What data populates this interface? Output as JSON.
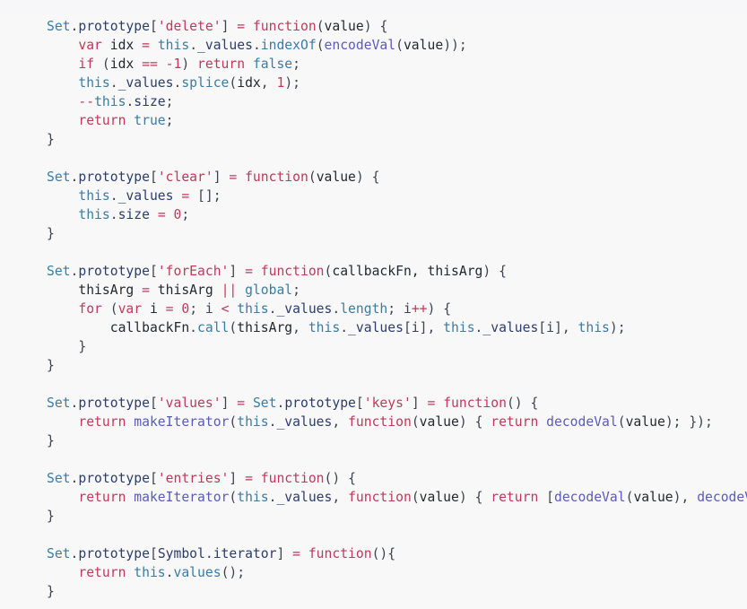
{
  "editor": {
    "language": "javascript",
    "background_color": "#f8f8f9",
    "default_text_color": "#24292e",
    "indent": "    ",
    "clipped_right_edge": true,
    "colors": {
      "class_or_builtin": "#3b7ca3",
      "property": "#2b3d6b",
      "keyword": "#c0395a",
      "string": "#c0395a",
      "number": "#c0395a",
      "operator": "#c0395a",
      "function_call": "#5a5ac0",
      "method": "#3b7ca3",
      "punctuation": "#3d4450"
    }
  },
  "code": {
    "lines": [
      "Set.prototype['delete'] = function(value) {",
      "    var idx = this._values.indexOf(encodeVal(value));",
      "    if (idx == -1) return false;",
      "    this._values.splice(idx, 1);",
      "    --this.size;",
      "    return true;",
      "}",
      "",
      "Set.prototype['clear'] = function(value) {",
      "    this._values = [];",
      "    this.size = 0;",
      "}",
      "",
      "Set.prototype['forEach'] = function(callbackFn, thisArg) {",
      "    thisArg = thisArg || global;",
      "    for (var i = 0; i < this._values.length; i++) {",
      "        callbackFn.call(thisArg, this._values[i], this._values[i], this);",
      "    }",
      "}",
      "",
      "Set.prototype['values'] = Set.prototype['keys'] = function() {",
      "    return makeIterator(this._values, function(value) { return decodeVal(value); });",
      "}",
      "",
      "Set.prototype['entries'] = function() {",
      "    return makeIterator(this._values, function(value) { return [decodeVal(value), decodeVal(value",
      "}",
      "",
      "Set.prototype[Symbol.iterator] = function(){",
      "    return this.values();",
      "}"
    ],
    "tokens": [
      [
        [
          "Set",
          "cls"
        ],
        [
          ".",
          "punc"
        ],
        [
          "prototype",
          "prop"
        ],
        [
          "[",
          "punc"
        ],
        [
          "'delete'",
          "str"
        ],
        [
          "]",
          "punc"
        ],
        [
          " ",
          "plain"
        ],
        [
          "=",
          "op"
        ],
        [
          " ",
          "plain"
        ],
        [
          "function",
          "kw"
        ],
        [
          "(",
          "punc"
        ],
        [
          "value",
          "plain"
        ],
        [
          ")",
          "punc"
        ],
        [
          " ",
          "plain"
        ],
        [
          "{",
          "punc"
        ]
      ],
      [
        [
          "    ",
          "plain"
        ],
        [
          "var",
          "kw"
        ],
        [
          " idx ",
          "plain"
        ],
        [
          "=",
          "op"
        ],
        [
          " ",
          "plain"
        ],
        [
          "this",
          "cls"
        ],
        [
          ".",
          "punc"
        ],
        [
          "_values",
          "prop"
        ],
        [
          ".",
          "punc"
        ],
        [
          "indexOf",
          "meth"
        ],
        [
          "(",
          "punc"
        ],
        [
          "encodeVal",
          "fn"
        ],
        [
          "(",
          "punc"
        ],
        [
          "value",
          "plain"
        ],
        [
          "))",
          "punc"
        ],
        [
          ";",
          "punc"
        ]
      ],
      [
        [
          "    ",
          "plain"
        ],
        [
          "if",
          "kw"
        ],
        [
          " ",
          "plain"
        ],
        [
          "(",
          "punc"
        ],
        [
          "idx ",
          "plain"
        ],
        [
          "==",
          "op"
        ],
        [
          " ",
          "plain"
        ],
        [
          "-1",
          "num"
        ],
        [
          ")",
          "punc"
        ],
        [
          " ",
          "plain"
        ],
        [
          "return",
          "kw"
        ],
        [
          " ",
          "plain"
        ],
        [
          "false",
          "cls"
        ],
        [
          ";",
          "punc"
        ]
      ],
      [
        [
          "    ",
          "plain"
        ],
        [
          "this",
          "cls"
        ],
        [
          ".",
          "punc"
        ],
        [
          "_values",
          "prop"
        ],
        [
          ".",
          "punc"
        ],
        [
          "splice",
          "meth"
        ],
        [
          "(",
          "punc"
        ],
        [
          "idx",
          "plain"
        ],
        [
          ", ",
          "punc"
        ],
        [
          "1",
          "num"
        ],
        [
          ")",
          "punc"
        ],
        [
          ";",
          "punc"
        ]
      ],
      [
        [
          "    ",
          "plain"
        ],
        [
          "--",
          "op"
        ],
        [
          "this",
          "cls"
        ],
        [
          ".",
          "punc"
        ],
        [
          "size",
          "prop"
        ],
        [
          ";",
          "punc"
        ]
      ],
      [
        [
          "    ",
          "plain"
        ],
        [
          "return",
          "kw"
        ],
        [
          " ",
          "plain"
        ],
        [
          "true",
          "cls"
        ],
        [
          ";",
          "punc"
        ]
      ],
      [
        [
          "}",
          "punc"
        ]
      ],
      [],
      [
        [
          "Set",
          "cls"
        ],
        [
          ".",
          "punc"
        ],
        [
          "prototype",
          "prop"
        ],
        [
          "[",
          "punc"
        ],
        [
          "'clear'",
          "str"
        ],
        [
          "]",
          "punc"
        ],
        [
          " ",
          "plain"
        ],
        [
          "=",
          "op"
        ],
        [
          " ",
          "plain"
        ],
        [
          "function",
          "kw"
        ],
        [
          "(",
          "punc"
        ],
        [
          "value",
          "plain"
        ],
        [
          ")",
          "punc"
        ],
        [
          " ",
          "plain"
        ],
        [
          "{",
          "punc"
        ]
      ],
      [
        [
          "    ",
          "plain"
        ],
        [
          "this",
          "cls"
        ],
        [
          ".",
          "punc"
        ],
        [
          "_values",
          "prop"
        ],
        [
          " ",
          "plain"
        ],
        [
          "=",
          "op"
        ],
        [
          " ",
          "plain"
        ],
        [
          "[]",
          "punc"
        ],
        [
          ";",
          "punc"
        ]
      ],
      [
        [
          "    ",
          "plain"
        ],
        [
          "this",
          "cls"
        ],
        [
          ".",
          "punc"
        ],
        [
          "size",
          "prop"
        ],
        [
          " ",
          "plain"
        ],
        [
          "=",
          "op"
        ],
        [
          " ",
          "plain"
        ],
        [
          "0",
          "num"
        ],
        [
          ";",
          "punc"
        ]
      ],
      [
        [
          "}",
          "punc"
        ]
      ],
      [],
      [
        [
          "Set",
          "cls"
        ],
        [
          ".",
          "punc"
        ],
        [
          "prototype",
          "prop"
        ],
        [
          "[",
          "punc"
        ],
        [
          "'forEach'",
          "str"
        ],
        [
          "]",
          "punc"
        ],
        [
          " ",
          "plain"
        ],
        [
          "=",
          "op"
        ],
        [
          " ",
          "plain"
        ],
        [
          "function",
          "kw"
        ],
        [
          "(",
          "punc"
        ],
        [
          "callbackFn, thisArg",
          "plain"
        ],
        [
          ")",
          "punc"
        ],
        [
          " ",
          "plain"
        ],
        [
          "{",
          "punc"
        ]
      ],
      [
        [
          "    thisArg ",
          "plain"
        ],
        [
          "=",
          "op"
        ],
        [
          " thisArg ",
          "plain"
        ],
        [
          "||",
          "op"
        ],
        [
          " ",
          "plain"
        ],
        [
          "global",
          "cls"
        ],
        [
          ";",
          "punc"
        ]
      ],
      [
        [
          "    ",
          "plain"
        ],
        [
          "for",
          "kw"
        ],
        [
          " ",
          "punc"
        ],
        [
          "(",
          "punc"
        ],
        [
          "var",
          "kw"
        ],
        [
          " i ",
          "plain"
        ],
        [
          "=",
          "op"
        ],
        [
          " ",
          "plain"
        ],
        [
          "0",
          "num"
        ],
        [
          "; i ",
          "punc"
        ],
        [
          "<",
          "op"
        ],
        [
          " ",
          "plain"
        ],
        [
          "this",
          "cls"
        ],
        [
          ".",
          "punc"
        ],
        [
          "_values",
          "prop"
        ],
        [
          ".",
          "punc"
        ],
        [
          "length",
          "meth"
        ],
        [
          "; i",
          "punc"
        ],
        [
          "++",
          "op"
        ],
        [
          ")",
          "punc"
        ],
        [
          " ",
          "plain"
        ],
        [
          "{",
          "punc"
        ]
      ],
      [
        [
          "        callbackFn",
          "plain"
        ],
        [
          ".",
          "punc"
        ],
        [
          "call",
          "meth"
        ],
        [
          "(",
          "punc"
        ],
        [
          "thisArg",
          "plain"
        ],
        [
          ", ",
          "punc"
        ],
        [
          "this",
          "cls"
        ],
        [
          ".",
          "punc"
        ],
        [
          "_values",
          "prop"
        ],
        [
          "[i]",
          "punc"
        ],
        [
          ", ",
          "punc"
        ],
        [
          "this",
          "cls"
        ],
        [
          ".",
          "punc"
        ],
        [
          "_values",
          "prop"
        ],
        [
          "[i]",
          "punc"
        ],
        [
          ", ",
          "punc"
        ],
        [
          "this",
          "cls"
        ],
        [
          ")",
          "punc"
        ],
        [
          ";",
          "punc"
        ]
      ],
      [
        [
          "    ",
          "plain"
        ],
        [
          "}",
          "punc"
        ]
      ],
      [
        [
          "}",
          "punc"
        ]
      ],
      [],
      [
        [
          "Set",
          "cls"
        ],
        [
          ".",
          "punc"
        ],
        [
          "prototype",
          "prop"
        ],
        [
          "[",
          "punc"
        ],
        [
          "'values'",
          "str"
        ],
        [
          "]",
          "punc"
        ],
        [
          " ",
          "plain"
        ],
        [
          "=",
          "op"
        ],
        [
          " ",
          "plain"
        ],
        [
          "Set",
          "cls"
        ],
        [
          ".",
          "punc"
        ],
        [
          "prototype",
          "prop"
        ],
        [
          "[",
          "punc"
        ],
        [
          "'keys'",
          "str"
        ],
        [
          "]",
          "punc"
        ],
        [
          " ",
          "plain"
        ],
        [
          "=",
          "op"
        ],
        [
          " ",
          "plain"
        ],
        [
          "function",
          "kw"
        ],
        [
          "()",
          "punc"
        ],
        [
          " ",
          "plain"
        ],
        [
          "{",
          "punc"
        ]
      ],
      [
        [
          "    ",
          "plain"
        ],
        [
          "return",
          "kw"
        ],
        [
          " ",
          "plain"
        ],
        [
          "makeIterator",
          "fn"
        ],
        [
          "(",
          "punc"
        ],
        [
          "this",
          "cls"
        ],
        [
          ".",
          "punc"
        ],
        [
          "_values",
          "prop"
        ],
        [
          ", ",
          "punc"
        ],
        [
          "function",
          "kw"
        ],
        [
          "(",
          "punc"
        ],
        [
          "value",
          "plain"
        ],
        [
          ")",
          "punc"
        ],
        [
          " ",
          "plain"
        ],
        [
          "{",
          "punc"
        ],
        [
          " ",
          "plain"
        ],
        [
          "return",
          "kw"
        ],
        [
          " ",
          "plain"
        ],
        [
          "decodeVal",
          "fn"
        ],
        [
          "(",
          "punc"
        ],
        [
          "value",
          "plain"
        ],
        [
          ")",
          "punc"
        ],
        [
          "; ",
          "punc"
        ],
        [
          "})",
          "punc"
        ],
        [
          ";",
          "punc"
        ]
      ],
      [
        [
          "}",
          "punc"
        ]
      ],
      [],
      [
        [
          "Set",
          "cls"
        ],
        [
          ".",
          "punc"
        ],
        [
          "prototype",
          "prop"
        ],
        [
          "[",
          "punc"
        ],
        [
          "'entries'",
          "str"
        ],
        [
          "]",
          "punc"
        ],
        [
          " ",
          "plain"
        ],
        [
          "=",
          "op"
        ],
        [
          " ",
          "plain"
        ],
        [
          "function",
          "kw"
        ],
        [
          "()",
          "punc"
        ],
        [
          " ",
          "plain"
        ],
        [
          "{",
          "punc"
        ]
      ],
      [
        [
          "    ",
          "plain"
        ],
        [
          "return",
          "kw"
        ],
        [
          " ",
          "plain"
        ],
        [
          "makeIterator",
          "fn"
        ],
        [
          "(",
          "punc"
        ],
        [
          "this",
          "cls"
        ],
        [
          ".",
          "punc"
        ],
        [
          "_values",
          "prop"
        ],
        [
          ", ",
          "punc"
        ],
        [
          "function",
          "kw"
        ],
        [
          "(",
          "punc"
        ],
        [
          "value",
          "plain"
        ],
        [
          ")",
          "punc"
        ],
        [
          " ",
          "plain"
        ],
        [
          "{",
          "punc"
        ],
        [
          " ",
          "plain"
        ],
        [
          "return",
          "kw"
        ],
        [
          " ",
          "plain"
        ],
        [
          "[",
          "punc"
        ],
        [
          "decodeVal",
          "fn"
        ],
        [
          "(",
          "punc"
        ],
        [
          "value",
          "plain"
        ],
        [
          ")",
          "punc"
        ],
        [
          ", ",
          "punc"
        ],
        [
          "decodeVal",
          "fn"
        ],
        [
          "(",
          "punc"
        ],
        [
          "valu",
          "plain"
        ]
      ],
      [
        [
          "}",
          "punc"
        ]
      ],
      [],
      [
        [
          "Set",
          "cls"
        ],
        [
          ".",
          "punc"
        ],
        [
          "prototype",
          "prop"
        ],
        [
          "[",
          "punc"
        ],
        [
          "Symbol",
          "prop"
        ],
        [
          ".",
          "punc"
        ],
        [
          "iterator",
          "prop"
        ],
        [
          "]",
          "punc"
        ],
        [
          " ",
          "plain"
        ],
        [
          "=",
          "op"
        ],
        [
          " ",
          "plain"
        ],
        [
          "function",
          "kw"
        ],
        [
          "(){",
          "punc"
        ]
      ],
      [
        [
          "    ",
          "plain"
        ],
        [
          "return",
          "kw"
        ],
        [
          " ",
          "plain"
        ],
        [
          "this",
          "cls"
        ],
        [
          ".",
          "punc"
        ],
        [
          "values",
          "meth"
        ],
        [
          "()",
          "punc"
        ],
        [
          ";",
          "punc"
        ]
      ],
      [
        [
          "}",
          "punc"
        ]
      ]
    ]
  }
}
